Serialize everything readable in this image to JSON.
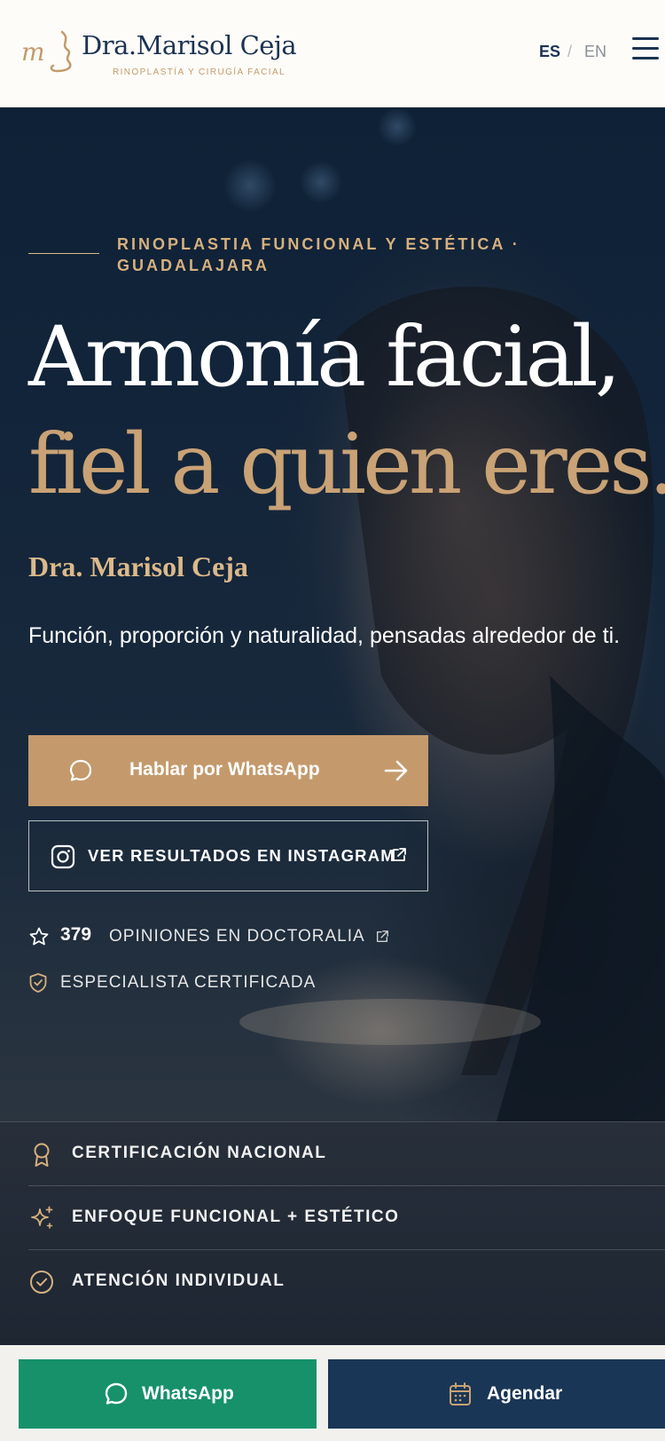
{
  "header": {
    "logo_initials": "m",
    "logo_name": "Dra.Marisol Ceja",
    "logo_tagline": "RINOPLASTÍA Y CIRUGÍA FACIAL",
    "lang_active": "ES",
    "lang_separator": "/",
    "lang_other": "EN",
    "menu_icon": "hamburger-menu-icon"
  },
  "hero": {
    "eyebrow": "RINOPLASTIA FUNCIONAL Y ESTÉTICA · GUADALAJARA",
    "headline_line1": "Armonía facial,",
    "headline_line2": "fiel a quien eres.",
    "doctor_name": "Dra. Marisol Ceja",
    "tagline": "Función, proporción y naturalidad, pensadas alrededor de ti.",
    "cta_primary": {
      "label": "Hablar por WhatsApp",
      "icon": "chat-bubble-icon",
      "trailing_icon": "arrow-right-icon"
    },
    "cta_secondary": {
      "label": "VER RESULTADOS EN INSTAGRAM",
      "icon": "instagram-icon",
      "trailing_icon": "external-link-icon"
    },
    "reviews": {
      "count": "379",
      "label": "OPINIONES EN DOCTORALIA",
      "icon": "star-icon",
      "trailing_icon": "external-link-icon"
    },
    "certified": {
      "label": "ESPECIALISTA CERTIFICADA",
      "icon": "shield-check-icon"
    }
  },
  "features": [
    {
      "label": "CERTIFICACIÓN NACIONAL",
      "icon": "award-ribbon-icon"
    },
    {
      "label": "ENFOQUE FUNCIONAL + ESTÉTICO",
      "icon": "sparkles-icon"
    },
    {
      "label": "ATENCIÓN INDIVIDUAL",
      "icon": "check-circle-icon"
    }
  ],
  "bottom_bar": {
    "whatsapp_label": "WhatsApp",
    "schedule_label": "Agendar"
  },
  "colors": {
    "navy": "#1c3352",
    "gold": "#c49a6c",
    "whatsapp_green": "#16916a",
    "schedule_navy": "#1a3656"
  }
}
